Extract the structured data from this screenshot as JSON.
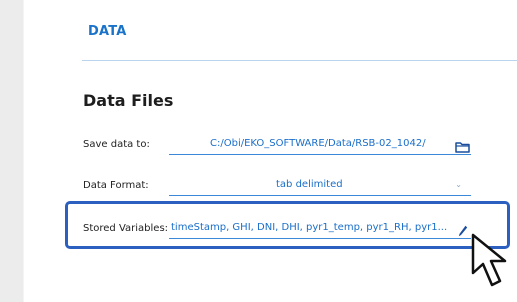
{
  "section_tab": "DATA",
  "panel": {
    "title": "Data Files"
  },
  "rows": {
    "save_path": {
      "label": "Save data to:",
      "value": "C:/Obi/EKO_SOFTWARE/Data/RSB-02_1042/",
      "icon": "folder-icon"
    },
    "data_format": {
      "label": "Data Format:",
      "value": "tab delimited",
      "icon": "chevron-down-icon"
    },
    "stored_variables": {
      "label": "Stored Variables:",
      "value": "timeStamp, GHI, DNI, DHI, pyr1_temp, pyr1_RH, pyr1...",
      "icon": "pencil-icon"
    }
  },
  "colors": {
    "accent": "#1a73c8",
    "field_text": "#1a6fc9",
    "highlight": "#2b5fc0"
  }
}
